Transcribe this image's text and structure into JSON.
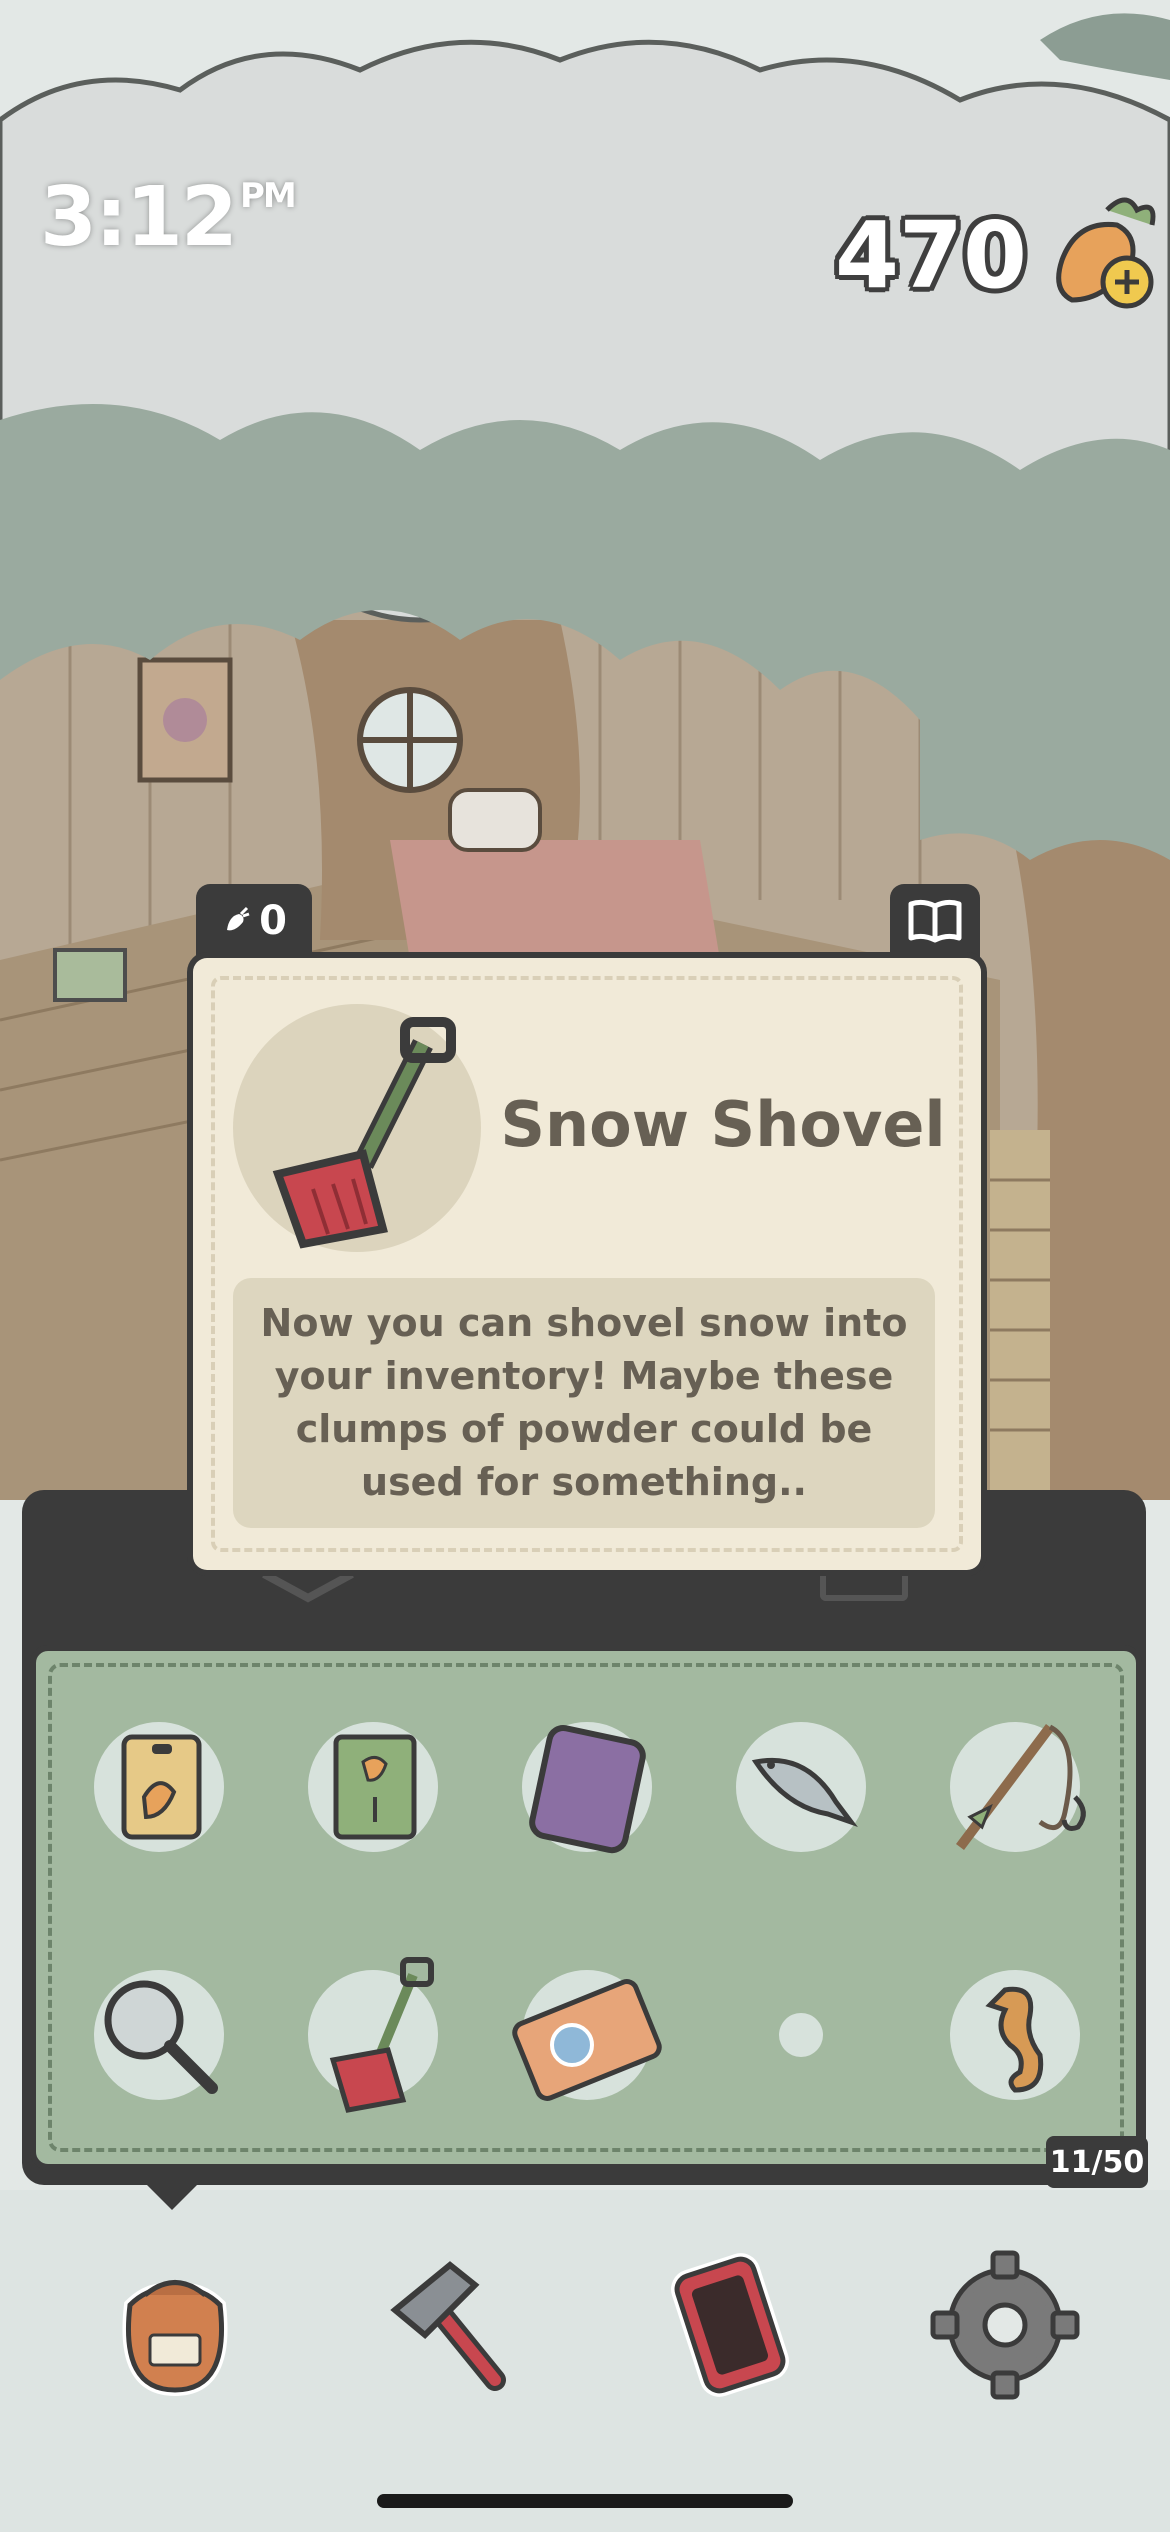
{
  "status": {
    "time": "3:12",
    "ampm": "PM"
  },
  "currency": {
    "amount": "470",
    "icon": "carrot-plus-icon"
  },
  "detail": {
    "count": "0",
    "item_name": "Snow Shovel",
    "description": "Now you can shovel snow into your inventory! Maybe these clumps of powder could be used for something.."
  },
  "inventory": {
    "capacity": "11/50",
    "items": [
      {
        "icon": "carrot-seed-packet-icon"
      },
      {
        "icon": "carrot-book-icon"
      },
      {
        "icon": "purple-tablet-icon"
      },
      {
        "icon": "fish-icon"
      },
      {
        "icon": "fishing-rod-icon"
      },
      {
        "icon": "magnifying-glass-icon"
      },
      {
        "icon": "snow-shovel-icon"
      },
      {
        "icon": "gacha-ticket-icon"
      },
      {
        "icon": "snowball-icon"
      },
      {
        "icon": "seahorse-icon"
      }
    ]
  },
  "nav": [
    "inventory-bag-icon",
    "hammer-icon",
    "phone-icon",
    "settings-gear-icon"
  ],
  "colors": {
    "panel": "#3b3b3b",
    "card": "#f1ead8",
    "grid": "#a3b9a0",
    "accent_red": "#c8474f"
  }
}
